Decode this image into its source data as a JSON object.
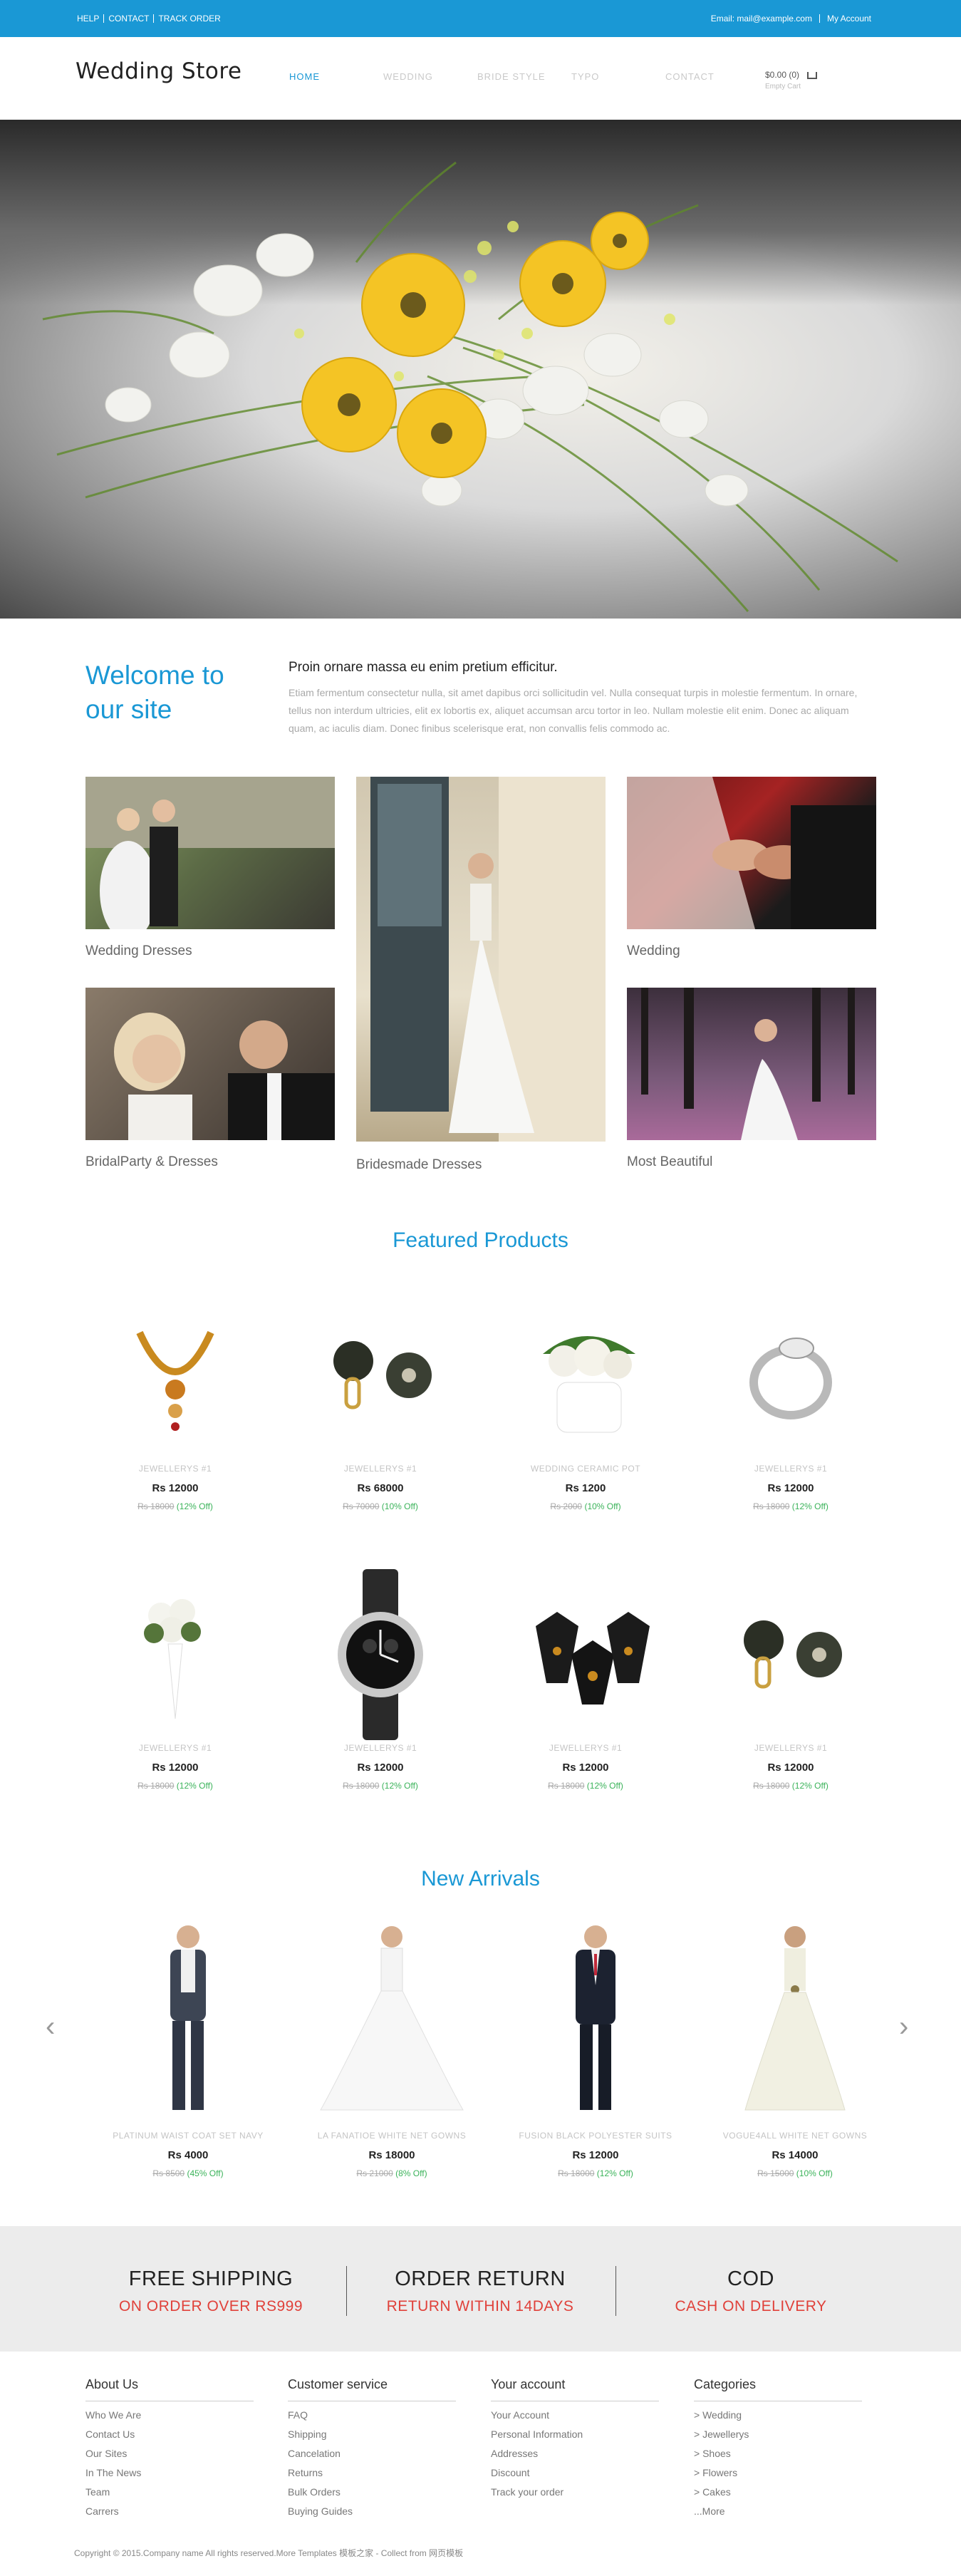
{
  "topbar": {
    "links": [
      "HELP",
      "CONTACT",
      "TRACK ORDER"
    ],
    "email": "Email: mail@example.com",
    "account": "My Account"
  },
  "header": {
    "logo": "Wedding Store",
    "nav": [
      "HOME",
      "WEDDING",
      "BRIDE STYLE",
      "TYPO",
      "CONTACT"
    ],
    "active_nav": "HOME",
    "cart_total": "$0.00 (0)",
    "cart_status": "Empty Cart"
  },
  "welcome": {
    "title": "Welcome to our site",
    "heading": "Proin ornare massa eu enim pretium efficitur.",
    "text": "Etiam fermentum consectetur nulla, sit amet dapibus orci sollicitudin vel. Nulla consequat turpis in molestie fermentum. In ornare, tellus non interdum ultricies, elit ex lobortis ex, aliquet accumsan arcu tortor in leo. Nullam molestie elit enim. Donec ac aliquam quam, ac iaculis diam. Donec finibus scelerisque erat, non convallis felis commodo ac."
  },
  "gallery": [
    "Wedding Dresses",
    "Wedding",
    "BridalParty & Dresses",
    "Bridesmade Dresses",
    "Most Beautiful"
  ],
  "featured": {
    "title": "Featured Products",
    "items": [
      {
        "name": "JEWELLERYS #1",
        "price": "Rs 12000",
        "old": "Rs 18000",
        "off": "(12% Off)"
      },
      {
        "name": "JEWELLERYS #1",
        "price": "Rs 68000",
        "old": "Rs 70000",
        "off": "(10% Off)"
      },
      {
        "name": "WEDDING CERAMIC POT",
        "price": "Rs 1200",
        "old": "Rs 2000",
        "off": "(10% Off)"
      },
      {
        "name": "JEWELLERYS #1",
        "price": "Rs 12000",
        "old": "Rs 18000",
        "off": "(12% Off)"
      },
      {
        "name": "JEWELLERYS #1",
        "price": "Rs 12000",
        "old": "Rs 18000",
        "off": "(12% Off)"
      },
      {
        "name": "JEWELLERYS #1",
        "price": "Rs 12000",
        "old": "Rs 18000",
        "off": "(12% Off)"
      },
      {
        "name": "JEWELLERYS #1",
        "price": "Rs 12000",
        "old": "Rs 18000",
        "off": "(12% Off)"
      },
      {
        "name": "JEWELLERYS #1",
        "price": "Rs 12000",
        "old": "Rs 18000",
        "off": "(12% Off)"
      }
    ]
  },
  "arrivals": {
    "title": "New Arrivals",
    "items": [
      {
        "name": "PLATINUM WAIST COAT SET NAVY",
        "price": "Rs 4000",
        "old": "Rs 8500",
        "off": "(45% Off)"
      },
      {
        "name": "LA FANATIOE WHITE NET GOWNS",
        "price": "Rs 18000",
        "old": "Rs 21000",
        "off": "(8% Off)"
      },
      {
        "name": "FUSION BLACK POLYESTER SUITS",
        "price": "Rs 12000",
        "old": "Rs 18000",
        "off": "(12% Off)"
      },
      {
        "name": "VOGUE4ALL WHITE NET GOWNS",
        "price": "Rs 14000",
        "old": "Rs 15000",
        "off": "(10% Off)"
      }
    ]
  },
  "services": [
    {
      "title": "FREE SHIPPING",
      "sub": "ON ORDER OVER RS999"
    },
    {
      "title": "ORDER RETURN",
      "sub": "RETURN WITHIN 14DAYS"
    },
    {
      "title": "COD",
      "sub": "CASH ON DELIVERY"
    }
  ],
  "footer": {
    "columns": [
      {
        "heading": "About Us",
        "links": [
          "Who We Are",
          "Contact Us",
          "Our Sites",
          "In The News",
          "Team",
          "Carrers"
        ]
      },
      {
        "heading": "Customer service",
        "links": [
          "FAQ",
          "Shipping",
          "Cancelation",
          "Returns",
          "Bulk Orders",
          "Buying Guides"
        ]
      },
      {
        "heading": "Your account",
        "links": [
          "Your Account",
          "Personal Information",
          "Addresses",
          "Discount",
          "Track your order"
        ]
      },
      {
        "heading": "Categories",
        "links": [
          "> Wedding",
          "> Jewellerys",
          "> Shoes",
          "> Flowers",
          "> Cakes",
          "...More"
        ]
      }
    ],
    "copyright": "Copyright © 2015.Company name All rights reserved.More Templates 模板之家 - Collect from 网页模板"
  },
  "colors": {
    "accent": "#1a98d5",
    "sale": "#e0413a",
    "discount": "#3bb35a"
  }
}
